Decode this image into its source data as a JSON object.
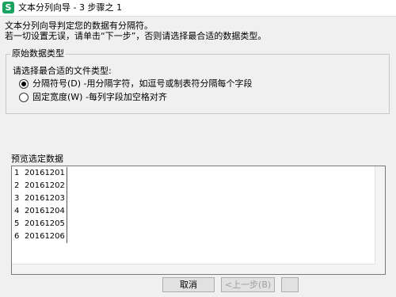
{
  "window": {
    "title": "文本分列向导 - 3 步骤之 1",
    "app_icon_letter": "S"
  },
  "description": {
    "line1": "文本分列向导判定您的数据有分隔符。",
    "line2": "若一切设置无误，请单击“下一步”，否则请选择最合适的数据类型。"
  },
  "original_type": {
    "group_label": "原始数据类型",
    "prompt": "请选择最合适的文件类型:",
    "options": [
      {
        "label": "分隔符号(D) -用分隔字符，如逗号或制表符分隔每个字段",
        "selected": true
      },
      {
        "label": "固定宽度(W) -每列字段加空格对齐",
        "selected": false
      }
    ]
  },
  "preview": {
    "group_label": "预览选定数据",
    "rows": [
      {
        "num": "1",
        "value": "20161201"
      },
      {
        "num": "2",
        "value": "20161202"
      },
      {
        "num": "3",
        "value": "20161203"
      },
      {
        "num": "4",
        "value": "20161204"
      },
      {
        "num": "5",
        "value": "20161205"
      },
      {
        "num": "6",
        "value": "20161206"
      }
    ]
  },
  "buttons": {
    "cancel": "取消",
    "back": "<上一步(B)"
  }
}
